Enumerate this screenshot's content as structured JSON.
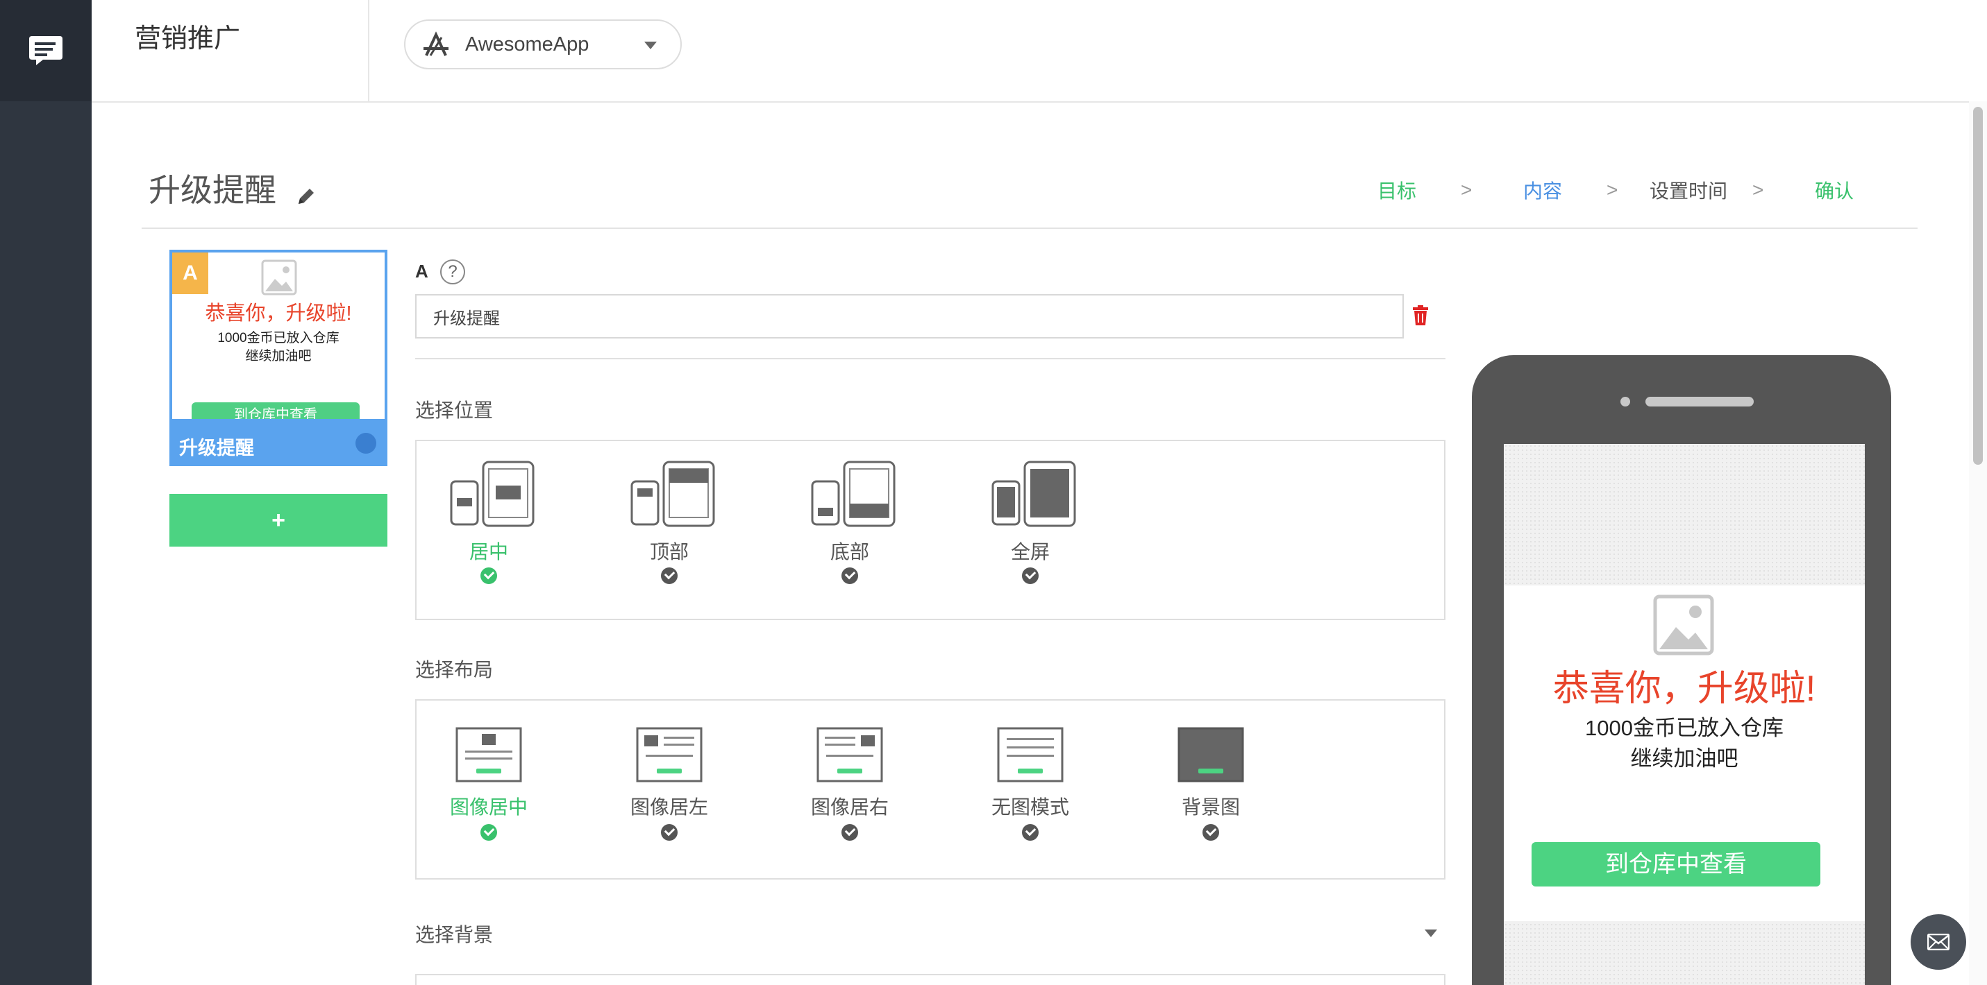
{
  "header": {
    "brand": "营销推广",
    "app_selector": {
      "value": "AwesomeApp"
    }
  },
  "page": {
    "title": "升级提醒",
    "steps": [
      {
        "label": "目标",
        "color": "#39c16c"
      },
      {
        "label": "内容",
        "color": "#4a90e2"
      },
      {
        "label": "设置时间",
        "color": "#555555"
      },
      {
        "label": "确认",
        "color": "#39c16c"
      }
    ],
    "step_separator": ">"
  },
  "variant_card": {
    "badge": "A",
    "headline": "恭喜你，升级啦!",
    "body_line1": "1000金币已放入仓库",
    "body_line2": "继续加油吧",
    "cta": "到仓库中查看",
    "footer_label": "升级提醒"
  },
  "add_variant_label": "+",
  "form": {
    "variant_letter": "A",
    "help": "?",
    "name_value": "升级提醒",
    "position_label": "选择位置",
    "positions": [
      {
        "label": "居中",
        "selected": true
      },
      {
        "label": "顶部",
        "selected": false
      },
      {
        "label": "底部",
        "selected": false
      },
      {
        "label": "全屏",
        "selected": false
      }
    ],
    "layout_label": "选择布局",
    "layouts": [
      {
        "label": "图像居中",
        "selected": true
      },
      {
        "label": "图像居左",
        "selected": false
      },
      {
        "label": "图像居右",
        "selected": false
      },
      {
        "label": "无图模式",
        "selected": false
      },
      {
        "label": "背景图",
        "selected": false
      }
    ],
    "background_label": "选择背景"
  },
  "preview": {
    "headline": "恭喜你，升级啦!",
    "body_line1": "1000金币已放入仓库",
    "body_line2": "继续加油吧",
    "cta": "到仓库中查看"
  },
  "colors": {
    "accent_green": "#4cd382",
    "accent_blue": "#5aa3ee",
    "headline_red": "#e8442b",
    "rail": "#2f3640"
  }
}
